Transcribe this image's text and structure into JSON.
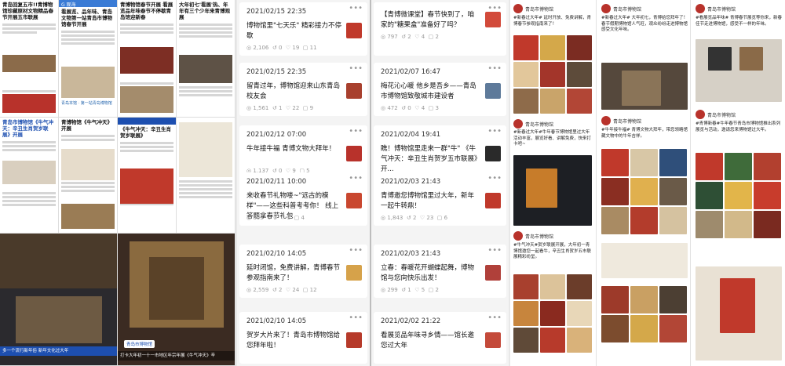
{
  "news": {
    "s1": {
      "headline": "青岛回复五市!!青博物馆珍藏原材文物精品春节开展五市联展"
    },
    "s2": {
      "brand": "G 观海",
      "headline": "看展览、品年味、青岛文物第一站青岛市博物馆春节开展"
    },
    "s3": {
      "headline": "青博物馆春节开展 看展览品年味春节不停歇青岛馆迎新春"
    },
    "s4": {
      "headline": "大年初七'看展'热、年年有三个少年来青博观展"
    },
    "s5": {
      "headline": "青岛市博物馆《牛气冲天：辛丑生肖贺岁联展》开展"
    },
    "s6": {
      "headline": "青博物馆《牛气冲天》开展"
    },
    "s7": {
      "headline": "《牛气冲天：辛丑生肖贺岁联展》"
    },
    "s8": {
      "caption": "多一个流行新年俗 新年文化过大年"
    },
    "s9": {
      "caption": "打卡大年初一十一市地区年宗年展《牛气冲天》辛"
    },
    "s9_badge": {
      "label": "青岛市博物馆"
    },
    "s2_caption": {
      "text": "青岛本馆 · 第一站青岛博物馆"
    }
  },
  "feed1": {
    "cards": [
      {
        "date": "2021/02/15 22:35",
        "title": "博物馆里\"七天乐\" 精彩接力不停歇",
        "views": "2,106",
        "c2": "0",
        "c3": "19",
        "c4": "11"
      },
      {
        "date": "2021/02/15 22:35",
        "title": "留青过年，博物馆迎来山东青岛校友会",
        "views": "1,561",
        "c2": "1",
        "c3": "22",
        "c4": "9"
      },
      {
        "date": "2021/02/12 07:00",
        "title": "牛年接牛福 青博文物大拜年！",
        "views": "1,137",
        "c2": "0",
        "c3": "9",
        "c4": "5"
      },
      {
        "date": "2021/02/11 10:00",
        "title": "来收春节礼物喽~\"远古的模样\"——这些科普考考你！ 线上答题拿春节礼包",
        "views": "805",
        "c2": "0",
        "c3": "5",
        "c4": "4"
      },
      {
        "date": "2021/02/10 14:05",
        "title": "延时闭馆，免费讲解，青博春节参观指南来了！",
        "views": "2,559",
        "c2": "2",
        "c3": "24",
        "c4": "12"
      },
      {
        "date": "2021/02/10 14:05",
        "title": "贺岁大片来了！青岛市博物馆给您拜年啦！",
        "views": "",
        "c2": "",
        "c3": "",
        "c4": ""
      }
    ]
  },
  "feed2": {
    "cards": [
      {
        "date": "",
        "title": "【青博微课堂】春节快到了，咱家的\"糖果盒\"准备好了吗？",
        "views": "797",
        "c2": "2",
        "c3": "4",
        "c4": "2"
      },
      {
        "date": "2021/02/07 16:47",
        "title": "梅花沁心暖 他乡是吾乡——青岛市博物馆致敬城市建设者",
        "views": "472",
        "c2": "0",
        "c3": "4",
        "c4": "3"
      },
      {
        "date": "2021/02/04 19:41",
        "title": "瞧！博物馆里走来一群\"牛\" 《牛气冲天：辛丑生肖贺岁五市联展》开...",
        "views": "",
        "c2": "",
        "c3": "",
        "c4": ""
      },
      {
        "date": "2021/02/03 21:43",
        "title": "青博邀您博物馆里过大年，新年一起牛转鼎！",
        "views": "1,843",
        "c2": "2",
        "c3": "23",
        "c4": "6"
      },
      {
        "date": "2021/02/03 21:43",
        "title": "立春：春暖花开蝴蝶起舞，博物馆与您向快乐出发！",
        "views": "299",
        "c2": "1",
        "c3": "5",
        "c4": "2"
      },
      {
        "date": "2021/02/02 21:22",
        "title": "看展览品年味寻乡情——馆长邀您过大年",
        "views": "",
        "c2": "",
        "c3": "",
        "c4": ""
      }
    ]
  },
  "weibo": {
    "c1": {
      "name": "青岛市博物馆",
      "text1": "#新春过大年# 延时开放、免费讲解，青博春节参观指南来了！",
      "name2": "青岛市博物馆",
      "text2": "#新春过大年#牛年春节博物馆里过大年活动丰富，展览好看、讲解免费，快来打卡吧~",
      "name3": "青岛市博物馆",
      "text3": "#牛气冲天#贺岁联展开展，大年初一青博馆邀您一起看牛，辛丑生肖贺岁五市联展精彩纷呈。"
    },
    "c2": {
      "name": "青岛市博物馆",
      "text1": "#新春过大年# 大年初七，青博给您拜年了！春节假期博物馆人气旺，观众纷纷走进博物馆感受文化年味。",
      "name2": "青岛市博物馆",
      "text2": "#牛年接牛福# 青博文物大拜年，带您领略馆藏文物中的牛年吉祥。"
    },
    "c3": {
      "name": "青岛市博物馆",
      "text1": "#看展览品年味# 青博春节展览等你来，新春佳节走进博物馆，感受不一样的年味。",
      "name2": "青岛市博物馆",
      "text2": "#青博新春#牛年春节青岛市博物馆推出系列展览与活动，邀请您来博物馆过大年。"
    }
  }
}
